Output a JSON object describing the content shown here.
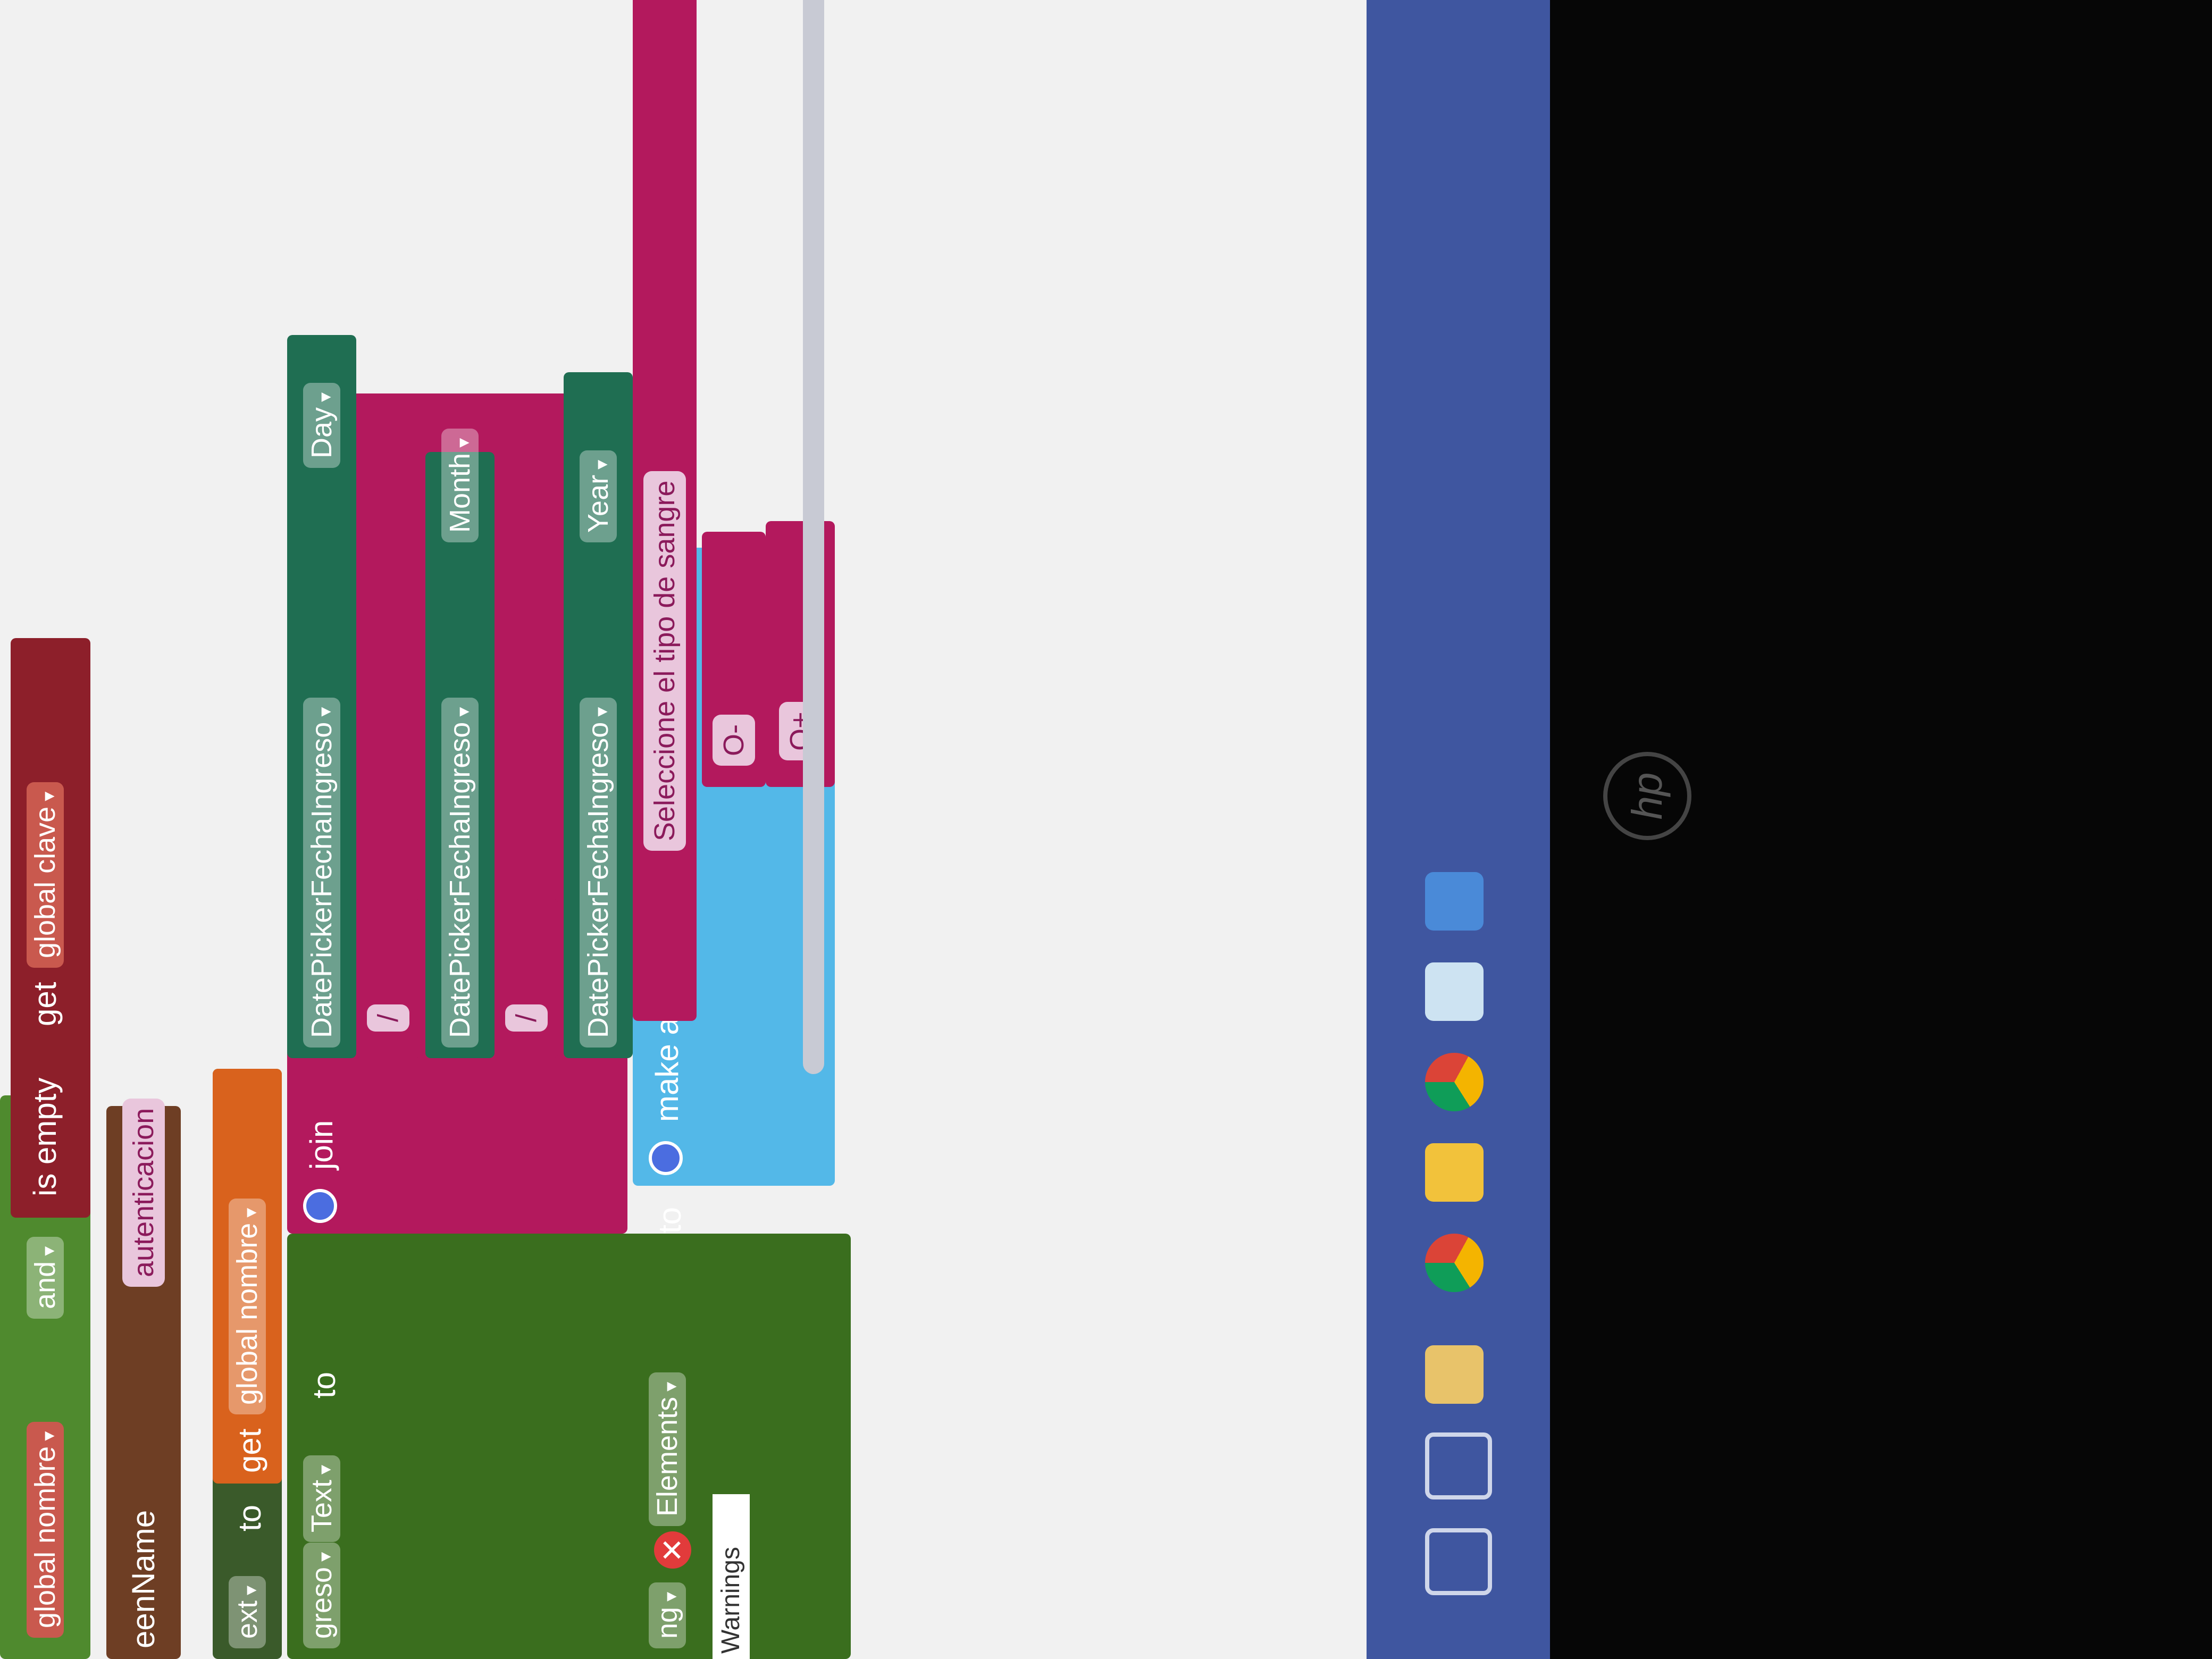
{
  "blocks": {
    "row1": {
      "get_left": "global nombre",
      "and": "and",
      "is_empty": "is empty",
      "get_kw": "get",
      "get_right": "global clave"
    },
    "row2": {
      "screen": "eenName",
      "text": "autenticacion"
    },
    "row3": {
      "text_prop": "ext",
      "to": "to",
      "get_kw": "get",
      "get_var": "global nombre"
    },
    "row4": {
      "comp": "greso",
      "prop": "Text",
      "to": "to",
      "join": "join"
    },
    "join_items": [
      {
        "component": "DatePickerFechaIngreso",
        "prop": "Day"
      },
      {
        "sep": "/"
      },
      {
        "component": "DatePickerFechaIngreso",
        "prop": "Month"
      },
      {
        "sep": "/"
      },
      {
        "component": "DatePickerFechaIngreso",
        "prop": "Year"
      }
    ],
    "row5": {
      "comp": "ng",
      "prop": "Elements",
      "to": "to",
      "make_list": "make a list"
    },
    "list_items": [
      "Seleccione el tipo de sangre",
      "O-",
      "O+"
    ],
    "warnings": "Warnings"
  },
  "colors": {
    "workspace": "#f1f1f1",
    "taskbar": "#3f56a0",
    "logic_green": "#4f8a2e",
    "text_magenta": "#b3195d",
    "variable_orange": "#d9621d",
    "component_teal": "#1f6e52",
    "list_blue": "#53b8e8",
    "set_darkgreen": "#3a6e1e"
  },
  "taskbar_icons": [
    "power-icon",
    "task-view-icon",
    "file-explorer-icon",
    "chrome-icon",
    "app-icon",
    "chrome-icon",
    "notepad-icon",
    "paint-icon"
  ],
  "logo": "hp"
}
